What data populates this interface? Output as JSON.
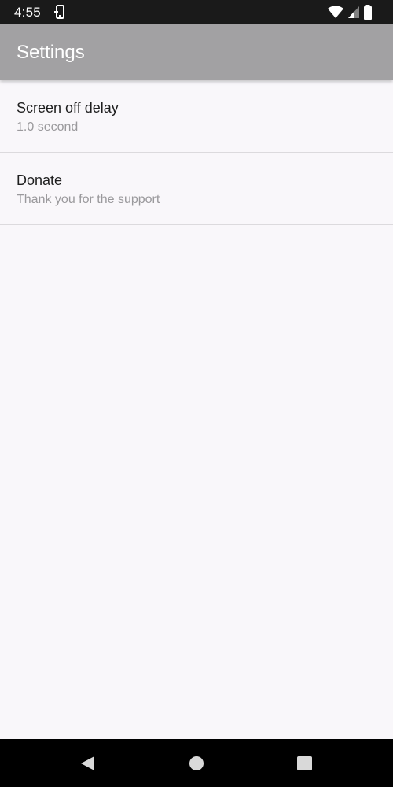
{
  "status_bar": {
    "time": "4:55",
    "icons": [
      "phone-sync-icon",
      "wifi-icon",
      "cell-signal-icon",
      "battery-icon"
    ]
  },
  "app_bar": {
    "title": "Settings"
  },
  "preferences": [
    {
      "title": "Screen off delay",
      "summary": "1.0 second"
    },
    {
      "title": "Donate",
      "summary": "Thank you for the support"
    }
  ],
  "nav_bar": {
    "buttons": [
      "back-icon",
      "home-icon",
      "recents-icon"
    ]
  },
  "colors": {
    "app_bar": "#a2a1a3",
    "background": "#f9f7fa",
    "status_bar": "#1a1a1a",
    "nav_bar": "#000000",
    "title_text": "#1f1f1f",
    "summary_text": "#9a999c"
  }
}
